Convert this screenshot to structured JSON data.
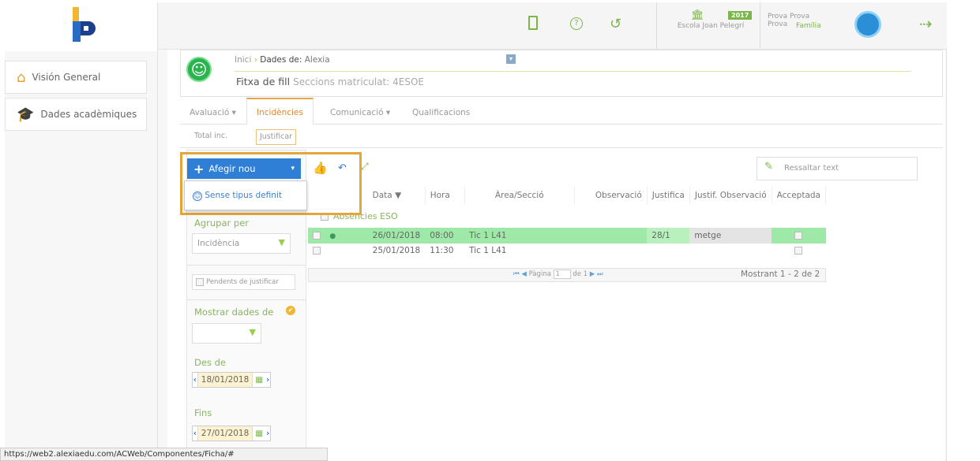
{
  "nav": {
    "items": [
      {
        "label": "Visión General"
      },
      {
        "label": "Dades acadèmiques"
      }
    ]
  },
  "top": {
    "year": "2017",
    "school": "Escola Joan Pelegrí",
    "user_name": "Prova Prova Prova",
    "user_role": "Família"
  },
  "header": {
    "crumb_home": "Inici",
    "crumb_sep": "›",
    "crumb_label": "Dades de:",
    "crumb_name": "Alexia",
    "title": "Fitxa de fill",
    "subtitle": "Seccions matriculat: 4ESOE"
  },
  "tabs": [
    {
      "label": "Avaluació ▾"
    },
    {
      "label": "Incidències"
    },
    {
      "label": "Comunicació ▾"
    },
    {
      "label": "Qualificacions"
    }
  ],
  "subtabs": {
    "total": "Total inc.",
    "justificar": "Justificar"
  },
  "toolbar": {
    "add": "Afegir nou",
    "dropdown_item": "Sense tipus definit",
    "ressaltar": "Ressaltar text"
  },
  "side": {
    "agrupar_label": "Agrupar per",
    "agrupar_value": "Incidència",
    "pendents": "Pendents de justificar",
    "mostrar_label": "Mostrar dades de",
    "mostrar_value": "",
    "des_label": "Des de",
    "des_value": "18/01/2018",
    "fins_label": "Fins",
    "fins_value": "27/01/2018"
  },
  "grid": {
    "columns": [
      "Data ▼",
      "Hora",
      "Àrea/Secció",
      "Observació",
      "Justifica",
      "Justif. Observació",
      "Acceptada"
    ],
    "group": "Absències ESO",
    "rows": [
      {
        "date": "26/01/2018",
        "time": "08:00",
        "area": "Tic 1 L41",
        "obs": "",
        "just": "28/1",
        "jobs": "metge"
      },
      {
        "date": "25/01/2018",
        "time": "11:30",
        "area": "Tic 1 L41",
        "obs": "",
        "just": "",
        "jobs": ""
      }
    ],
    "pager_label": "Pàgina",
    "pager_page": "1",
    "pager_of": "de 1",
    "showing": "Mostrant 1 - 2 de 2"
  },
  "status_url": "https://web2.alexiaedu.com/ACWeb/Componentes/Ficha/#"
}
